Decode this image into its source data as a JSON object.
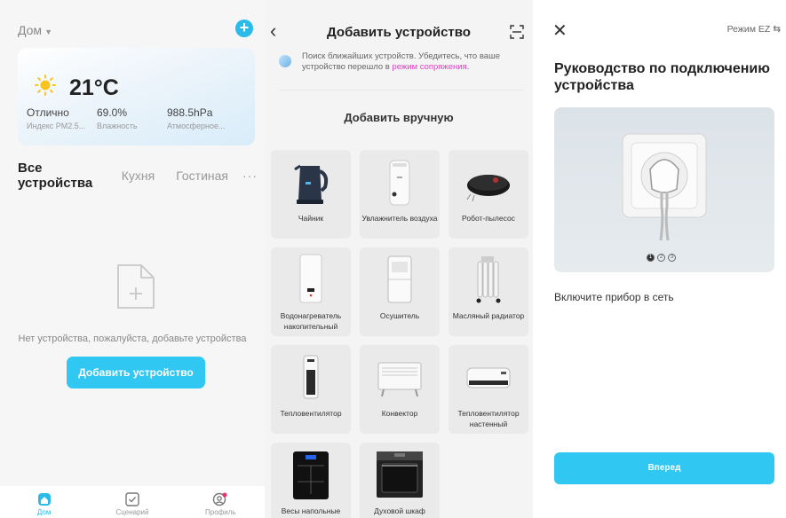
{
  "home": {
    "home_name": "Дом",
    "weather": {
      "temperature": "21°C",
      "stats": [
        {
          "value": "Отлично",
          "label": "Индекс PM2.5..."
        },
        {
          "value": "69.0%",
          "label": "Влажность"
        },
        {
          "value": "988.5hPa",
          "label": "Атмосферное..."
        }
      ]
    },
    "tabs": [
      "Все устройства",
      "Кухня",
      "Гостиная"
    ],
    "more": "···",
    "empty_message": "Нет устройства, пожалуйста, добавьте устройства",
    "add_button": "Добавить устройство",
    "nav": [
      {
        "label": "Дом",
        "icon": "home-icon",
        "active": true
      },
      {
        "label": "Сценарий",
        "icon": "scenario-icon",
        "active": false
      },
      {
        "label": "Профиль",
        "icon": "profile-icon",
        "active": false
      }
    ],
    "accent_color": "#30c7f3"
  },
  "add_device": {
    "title": "Добавить устройство",
    "search_text": "Поиск ближайших устройств. Убедитесь, что ваше устройство перешло в",
    "search_link": "режим сопряжения",
    "search_end": ".",
    "manual_title": "Добавить вручную",
    "devices": [
      {
        "name": "Чайник",
        "icon": "kettle-icon"
      },
      {
        "name": "Увлажнитель воздуха",
        "icon": "humidifier-icon"
      },
      {
        "name": "Робот-пылесос",
        "icon": "robot-vacuum-icon"
      },
      {
        "name": "Водонагреватель накопительный",
        "icon": "water-heater-icon"
      },
      {
        "name": "Осушитель",
        "icon": "dehumidifier-icon"
      },
      {
        "name": "Масляный радиатор",
        "icon": "oil-radiator-icon"
      },
      {
        "name": "Тепловентилятор",
        "icon": "fan-heater-icon"
      },
      {
        "name": "Конвектор",
        "icon": "convector-icon"
      },
      {
        "name": "Тепловентилятор настенный",
        "icon": "wall-fan-heater-icon"
      },
      {
        "name": "Весы напольные",
        "icon": "floor-scale-icon"
      },
      {
        "name": "Духовой шкаф",
        "icon": "oven-icon"
      }
    ]
  },
  "guide": {
    "mode": "Режим EZ ⇆",
    "title": "Руководство по подключению устройства",
    "steps": [
      "1",
      "2",
      "3"
    ],
    "active_step": 1,
    "instruction": "Включите прибор в сеть",
    "next_button": "Вперед"
  }
}
